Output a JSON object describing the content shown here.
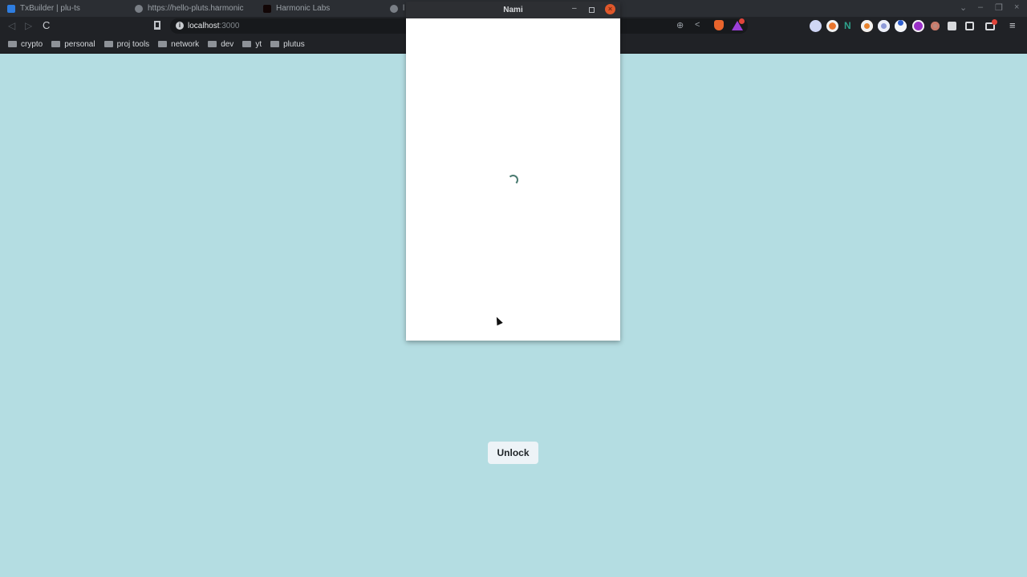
{
  "browser": {
    "tabs": [
      {
        "label": "TxBuilder | plu-ts",
        "icon": "app-favicon"
      },
      {
        "label": "https://hello-pluts.harmonic",
        "icon": "globe-icon"
      },
      {
        "label": "Harmonic Labs",
        "icon": "harmonic-favicon"
      },
      {
        "label": "l",
        "icon": "globe-icon"
      }
    ],
    "address_bar": {
      "host": "localhost",
      "port": ":3000"
    },
    "bookmarks": [
      "crypto",
      "personal",
      "proj tools",
      "network",
      "dev",
      "yt",
      "plutus"
    ],
    "extensions": [
      "extension-1",
      "extension-2",
      "extension-3",
      "metamask",
      "extension-5",
      "extension-6",
      "extension-7",
      "extension-8",
      "puzzle-extensions"
    ]
  },
  "popup": {
    "title": "Nami",
    "state": "loading"
  },
  "page": {
    "unlock_label": "Unlock"
  },
  "glyphs": {
    "back": "◁",
    "forward": "▷",
    "reload": "C",
    "info": "i",
    "zoom": "⊕",
    "share": "<",
    "menu": "≡",
    "chevron": "⌄",
    "minimize": "–",
    "maximize": "❐",
    "close": "×",
    "popup_min": "–",
    "popup_close": "×"
  }
}
